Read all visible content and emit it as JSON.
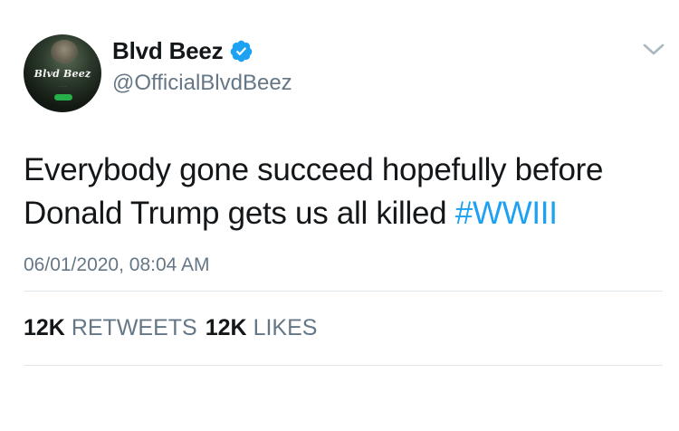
{
  "author": {
    "display_name": "Blvd Beez",
    "handle": "@OfficialBlvdBeez",
    "verified": true,
    "avatar": {
      "brand_text": "Blvd Beez",
      "icon": "profile-photo"
    }
  },
  "tweet": {
    "text": "Everybody gone succeed hopefully before Donald Trump gets us all killed ",
    "hashtag": "#WWIII",
    "timestamp": "06/01/2020, 08:04 AM"
  },
  "stats": {
    "retweets_count": "12K",
    "retweets_label": "RETWEETS",
    "likes_count": "12K",
    "likes_label": "LIKES"
  },
  "icons": {
    "verified": "verified-badge-icon",
    "menu": "chevron-down-icon"
  },
  "colors": {
    "text": "#14171a",
    "secondary": "#657786",
    "link": "#1da1f2",
    "verified": "#1da1f2",
    "divider": "#e1e8ed"
  }
}
